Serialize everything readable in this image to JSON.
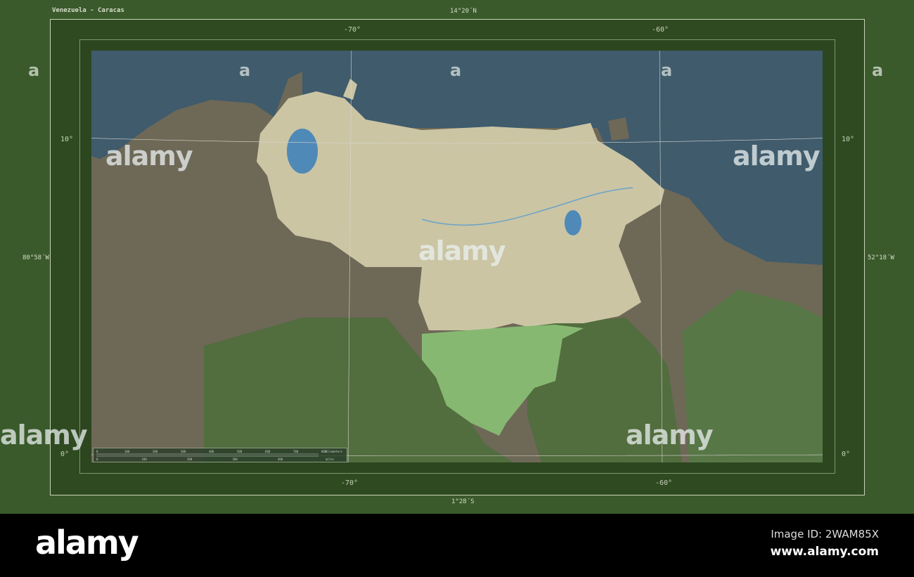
{
  "title": "Venezuela - Caracas",
  "bounds": {
    "north": "14°20´N",
    "south": "1°28´S",
    "west": "80°58´W",
    "east": "52°18´W"
  },
  "graticule": {
    "longitudes": [
      "-70°",
      "-60°"
    ],
    "latitudes": [
      "10°",
      "0°"
    ]
  },
  "scale_bar": {
    "km_ticks": [
      "0",
      "100",
      "200",
      "300",
      "400",
      "500",
      "600",
      "700",
      "800"
    ],
    "km_unit": "Kilometers",
    "mi_ticks": [
      "0",
      "100",
      "200",
      "300",
      "400"
    ],
    "mi_unit": "miles"
  },
  "colors": {
    "frame": "#3a5a2b",
    "ocean": "#3f5b6c",
    "land": "#6e6857",
    "highlight_country": "#cbc5a4",
    "forest": "#4f6e3c"
  },
  "watermark": {
    "text": "alamy",
    "letter": "a"
  },
  "footer": {
    "logo": "alamy",
    "image_id": "Image ID: 2WAM85X",
    "site": "www.alamy.com"
  }
}
